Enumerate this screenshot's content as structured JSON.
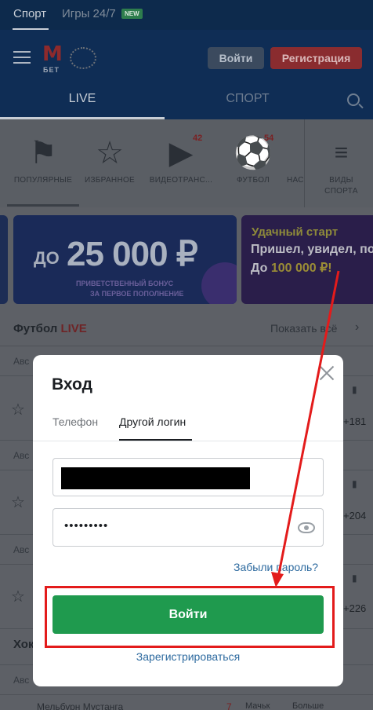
{
  "topnav": {
    "sport": "Спорт",
    "games": "Игры 24/7",
    "new_badge": "NEW"
  },
  "header": {
    "logo_letter": "M",
    "logo_word": "БЕТ",
    "login_button": "Войти",
    "register_button": "Регистрация",
    "menu_icon": "hamburger-icon"
  },
  "tabs": {
    "live": "LIVE",
    "sport": "СПОРТ",
    "search_icon": "search-icon"
  },
  "categories": {
    "popular": "ПОПУЛЯРНЫЕ",
    "favorites": "ИЗБРАННОЕ",
    "video": "ВИДЕОТРАНС...",
    "video_count": "42",
    "football": "ФУТБОЛ",
    "football_count": "54",
    "nas": "НАС",
    "sports_types_1": "ВИДЫ",
    "sports_types_2": "СПОРТА"
  },
  "banners": {
    "b1_prefix": "ДО",
    "b1_amount": "25 000 ₽",
    "b1_sub1": "ПРИВЕТСТВЕННЫЙ БОНУС",
    "b1_sub2": "ЗА ПЕРВОЕ ПОПОЛНЕНИЕ",
    "b2_line1": "Удачный старт",
    "b2_line2": "Пришел, увидел, по",
    "b2_line3_prefix": "До ",
    "b2_line3_amount": "100 000 ₽!"
  },
  "football_section": {
    "title": "Футбол",
    "live": "LIVE",
    "show_all": "Показать всё",
    "row_label": "Авс",
    "odds": [
      "+181",
      "+204",
      "+226"
    ]
  },
  "hockey_section": {
    "title": "Хок",
    "row_label": "Авс",
    "team": "Мельбурн Мустанга",
    "number": "7",
    "market1": "Мачьк",
    "market2": "Больше"
  },
  "modal": {
    "title": "Вход",
    "tab_phone": "Телефон",
    "tab_other": "Другой логин",
    "password_mask": "•••••••••",
    "forgot": "Забыли пароль?",
    "submit": "Войти",
    "register": "Зарегистрироваться"
  },
  "colors": {
    "annotation": "#e31b1b",
    "submit": "#1f9a4e",
    "link": "#2d6a9f"
  }
}
